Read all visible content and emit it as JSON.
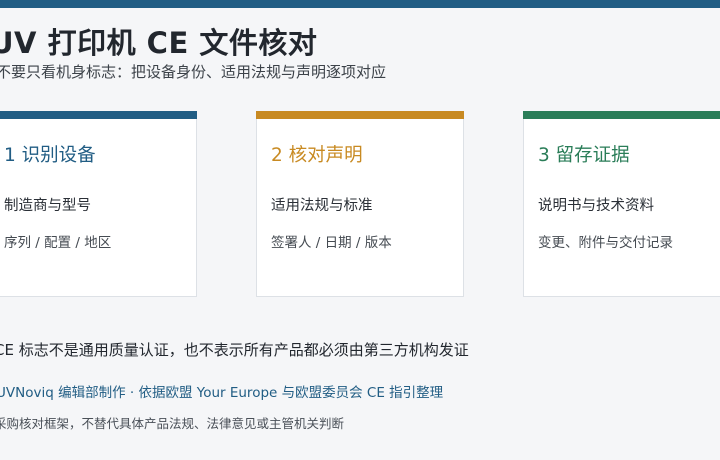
{
  "header": {
    "title": "UV 打印机 CE 文件核对",
    "subtitle": "不要只看机身标志：把设备身份、适用法规与声明逐项对应"
  },
  "cards": [
    {
      "heading": "1 识别设备",
      "line1": "制造商与型号",
      "line2": "序列 / 配置 / 地区",
      "accent_color": "#215d84"
    },
    {
      "heading": "2 核对声明",
      "line1": "适用法规与标准",
      "line2": "签署人 / 日期 / 版本",
      "accent_color": "#c88a22"
    },
    {
      "heading": "3 留存证据",
      "line1": "说明书与技术资料",
      "line2": "变更、附件与交付记录",
      "accent_color": "#2a7d58"
    }
  ],
  "footer": {
    "note": "CE 标志不是通用质量认证，也不表示所有产品都必须由第三方机构发证",
    "source": "UVNoviq 编辑部制作 · 依据欧盟 Your Europe 与欧盟委员会 CE 指引整理",
    "disclaimer": "采购核对框架，不替代具体产品法规、法律意见或主管机关判断"
  },
  "colors": {
    "top_bar": "#215d84",
    "background": "#f5f6f8"
  }
}
